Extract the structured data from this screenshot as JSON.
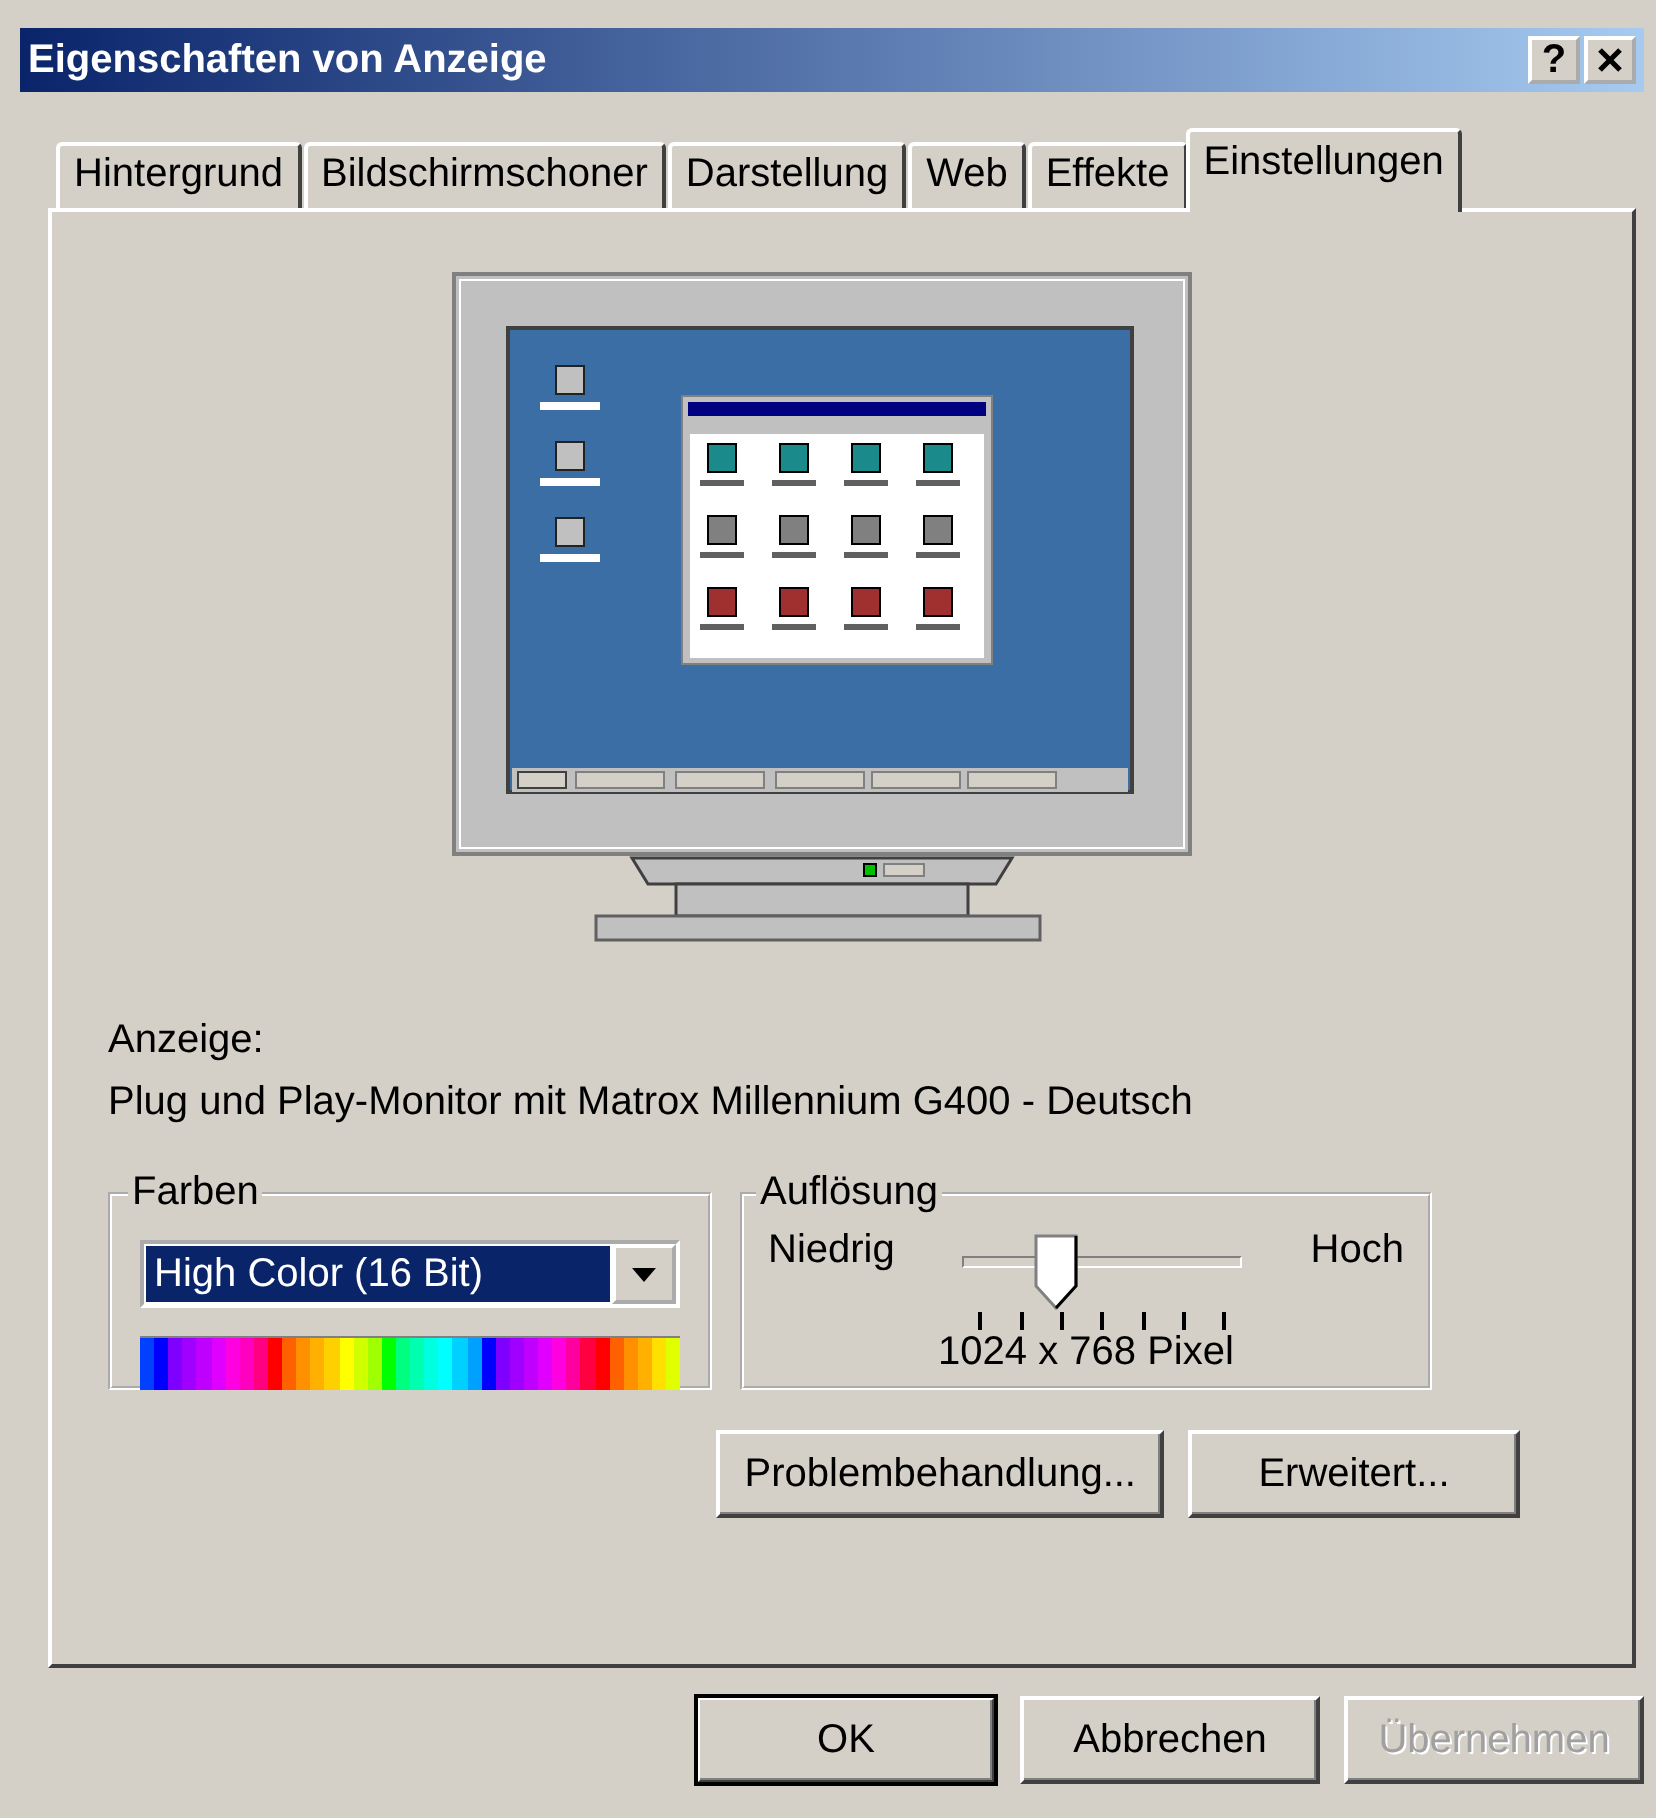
{
  "window": {
    "title": "Eigenschaften von Anzeige",
    "title_buttons": [
      {
        "kind": "help",
        "label": "?"
      },
      {
        "kind": "close"
      }
    ]
  },
  "tabs": [
    {
      "label": "Hintergrund",
      "selected": false
    },
    {
      "label": "Bildschirmschoner",
      "selected": false
    },
    {
      "label": "Darstellung",
      "selected": false
    },
    {
      "label": "Web",
      "selected": false
    },
    {
      "label": "Effekte",
      "selected": false
    },
    {
      "label": "Einstellungen",
      "selected": true
    }
  ],
  "display": {
    "label": "Anzeige:",
    "device": "Plug und Play-Monitor mit Matrox Millennium G400 - Deutsch"
  },
  "colors": {
    "title": "Farben",
    "value": "High Color (16 Bit)"
  },
  "resolution": {
    "title": "Auflösung",
    "low_label": "Niedrig",
    "high_label": "Hoch",
    "level": 0.3333,
    "reading": "1024 x 768 Pixel"
  },
  "panel_buttons": [
    {
      "label": "Problembehandlung..."
    },
    {
      "label": "Erweitert..."
    }
  ],
  "dialog_buttons": [
    {
      "label": "OK",
      "default": true,
      "disabled": false
    },
    {
      "label": "Abbrechen",
      "default": false,
      "disabled": false
    },
    {
      "label": "Übernehmen",
      "default": false,
      "disabled": true
    }
  ]
}
